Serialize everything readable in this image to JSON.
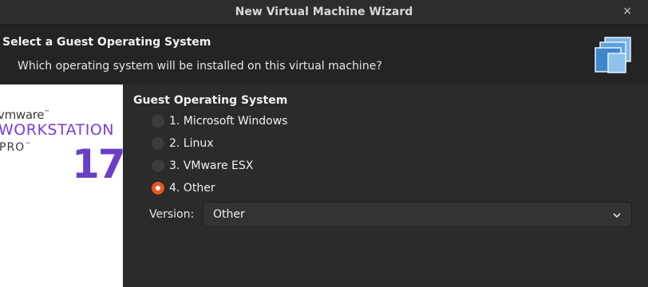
{
  "window": {
    "title": "New Virtual Machine Wizard",
    "close_glyph": "×"
  },
  "header": {
    "title": "Select a Guest Operating System",
    "subtitle": "Which operating system will be installed on this virtual machine?",
    "icon": "vm-stack-icon"
  },
  "branding": {
    "vmware": "vmware",
    "workstation": "WORKSTATION",
    "pro": "PRO",
    "tm": "™",
    "version_number": "17"
  },
  "guest_os": {
    "group_label": "Guest Operating System",
    "options": [
      {
        "label": "1. Microsoft Windows",
        "selected": false
      },
      {
        "label": "2. Linux",
        "selected": false
      },
      {
        "label": "3. VMware ESX",
        "selected": false
      },
      {
        "label": "4. Other",
        "selected": true
      }
    ]
  },
  "version": {
    "label": "Version:",
    "value": "Other"
  },
  "colors": {
    "accent": "#e95420",
    "brand_purple": "#7a3fd6"
  }
}
